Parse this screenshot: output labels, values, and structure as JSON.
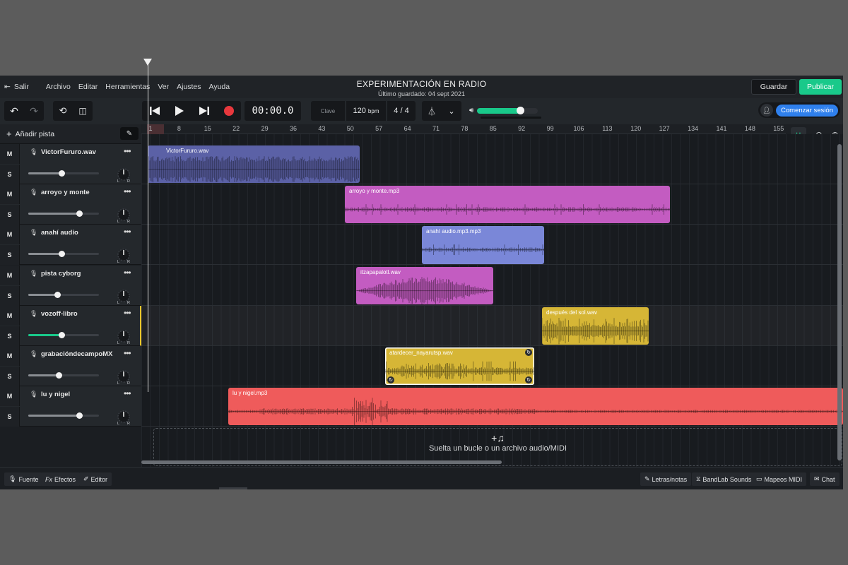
{
  "header": {
    "exit_label": "Salir",
    "menu": [
      "Archivo",
      "Editar",
      "Herramientas",
      "Ver",
      "Ajustes",
      "Ayuda"
    ],
    "project_title": "EXPERIMENTACIÓN EN RADIO",
    "last_saved": "Último guardado: 04 sept 2021",
    "save_label": "Guardar",
    "publish_label": "Publicar"
  },
  "transport": {
    "time": "00:00.0",
    "key_label": "Clave",
    "tempo": "120",
    "tempo_unit": "bpm",
    "time_signature": "4 / 4",
    "master_volume": 0.7,
    "session_label": "Comenzar sesión"
  },
  "tracks_panel": {
    "add_track_label": "Añadir pista",
    "mute_label": "M",
    "solo_label": "S",
    "pan_left": "L",
    "pan_right": "R"
  },
  "ruler": [
    "1",
    "8",
    "15",
    "22",
    "29",
    "36",
    "43",
    "50",
    "57",
    "64",
    "71",
    "78",
    "85",
    "92",
    "99",
    "106",
    "113",
    "120",
    "127",
    "134",
    "141",
    "148",
    "155"
  ],
  "tracks": [
    {
      "name": "VictorFururo.wav",
      "volume": 0.47,
      "selected": false,
      "clip": {
        "name": "VictorFururo.wav",
        "color": "#5b61a6"
      }
    },
    {
      "name": "arroyo y monte",
      "volume": 0.72,
      "selected": false,
      "clip": {
        "name": "arroyo y monte.mp3",
        "color": "#c35cc1"
      }
    },
    {
      "name": "anahí audio",
      "volume": 0.47,
      "selected": false,
      "clip": {
        "name": "anahí audio.mp3.mp3",
        "color": "#7a87d8"
      }
    },
    {
      "name": "pista cyborg",
      "volume": 0.41,
      "selected": false,
      "clip": {
        "name": "itzapapalotl.wav",
        "color": "#c35cc1"
      }
    },
    {
      "name": "vozoff-libro",
      "volume": 0.47,
      "selected": true,
      "clip": {
        "name": "después del sol.wav",
        "color": "#d6b636"
      }
    },
    {
      "name": "grabacióndecampoMX",
      "volume": 0.43,
      "selected": false,
      "clip": {
        "name": "atardecer_nayarutsp.wav",
        "color": "#d6b636"
      }
    },
    {
      "name": "lu y nigel",
      "volume": 0.72,
      "selected": false,
      "clip": {
        "name": "lu y nigel.mp3",
        "color": "#ef5b5b"
      }
    }
  ],
  "drop_zone": {
    "icon": "+♫",
    "text": "Suelta un bucle o un archivo audio/MIDI"
  },
  "bottom_bar": {
    "left": [
      "Fuente",
      "Efectos",
      "Editor"
    ],
    "fx_glyph": "Fx",
    "right": [
      "Letras/notas",
      "BandLab Sounds",
      "Mapeos MIDI",
      "Chat"
    ]
  }
}
